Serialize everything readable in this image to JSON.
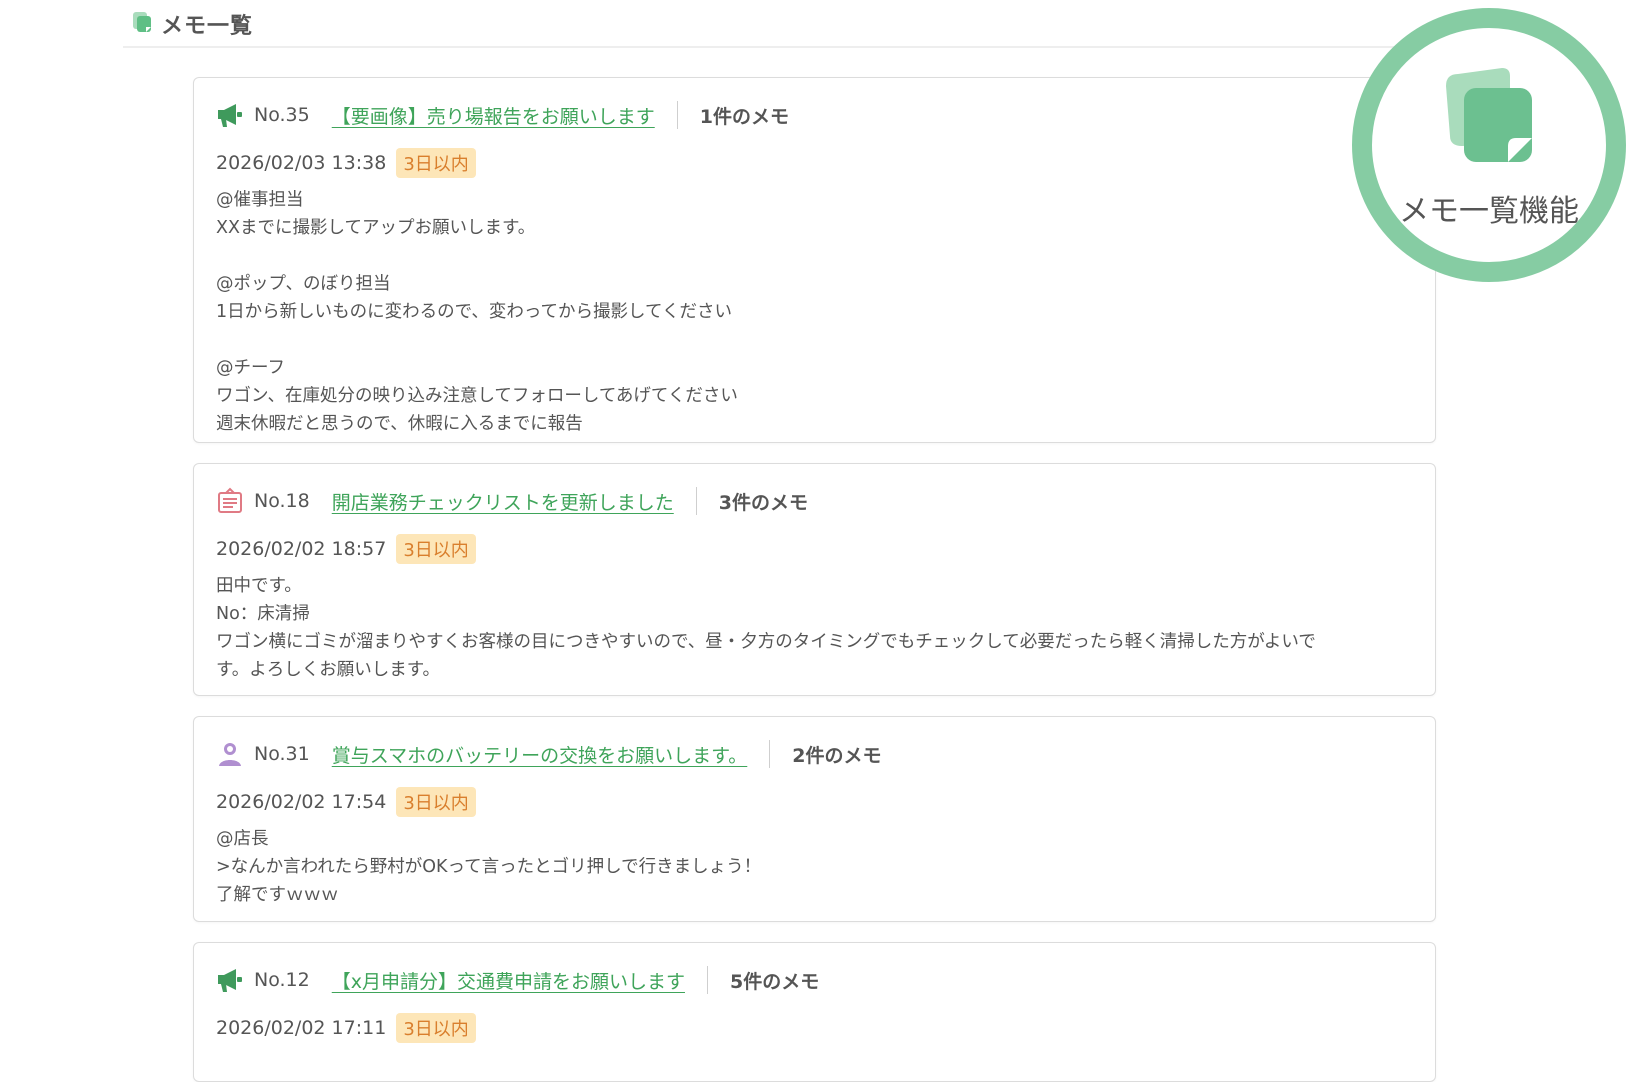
{
  "header": {
    "title": "メモ一覧",
    "icon": "memo-stack-icon"
  },
  "feature_badge": {
    "label": "メモ一覧機能",
    "icon": "memo-stack-icon",
    "ring_color": "#86cca3"
  },
  "memos": [
    {
      "category_icon": "megaphone-icon",
      "no": "No.35",
      "title": "【要画像】売り場報告をお願いします",
      "count": "1件のメモ",
      "date": "2026/02/03 13:38",
      "badge": "3日以内",
      "body": {
        "l1": "@催事担当",
        "l2": "XXまでに撮影してアップお願いします。",
        "l3": "@ポップ、のぼり担当",
        "l4": "1日から新しいものに変わるので、変わってから撮影してください",
        "l5": "@チーフ",
        "l6": "ワゴン、在庫処分の映り込み注意してフォローしてあげてください",
        "l7": "週末休暇だと思うので、休暇に入るまでに報告"
      }
    },
    {
      "category_icon": "clipboard-icon",
      "no": "No.18",
      "title": "開店業務チェックリストを更新しました",
      "count": "3件のメモ",
      "date": "2026/02/02 18:57",
      "badge": "3日以内",
      "body": {
        "l1": "田中です。",
        "l2": "No：床清掃",
        "l3": "ワゴン横にゴミが溜まりやすくお客様の目につきやすいので、昼・夕方のタイミングでもチェックして必要だったら軽く清掃した方がよいです。よろしくお願いします。"
      }
    },
    {
      "category_icon": "person-icon",
      "no": "No.31",
      "title": "賞与スマホのバッテリーの交換をお願いします。",
      "count": "2件のメモ",
      "date": "2026/02/02 17:54",
      "badge": "3日以内",
      "body": {
        "l1": "@店長",
        "l2": ">なんか言われたら野村がOKって言ったとゴリ押しで行きましょう！",
        "l3": "了解ですｗｗｗ"
      }
    },
    {
      "category_icon": "megaphone-icon",
      "no": "No.12",
      "title": "【x月申請分】交通費申請をお願いします",
      "count": "5件のメモ",
      "date": "2026/02/02 17:11",
      "badge": "3日以内"
    }
  ],
  "colors": {
    "link": "#3fa45a",
    "badge_bg": "#fde6b8",
    "badge_text": "#d97f2d",
    "accent": "#86cca3"
  }
}
